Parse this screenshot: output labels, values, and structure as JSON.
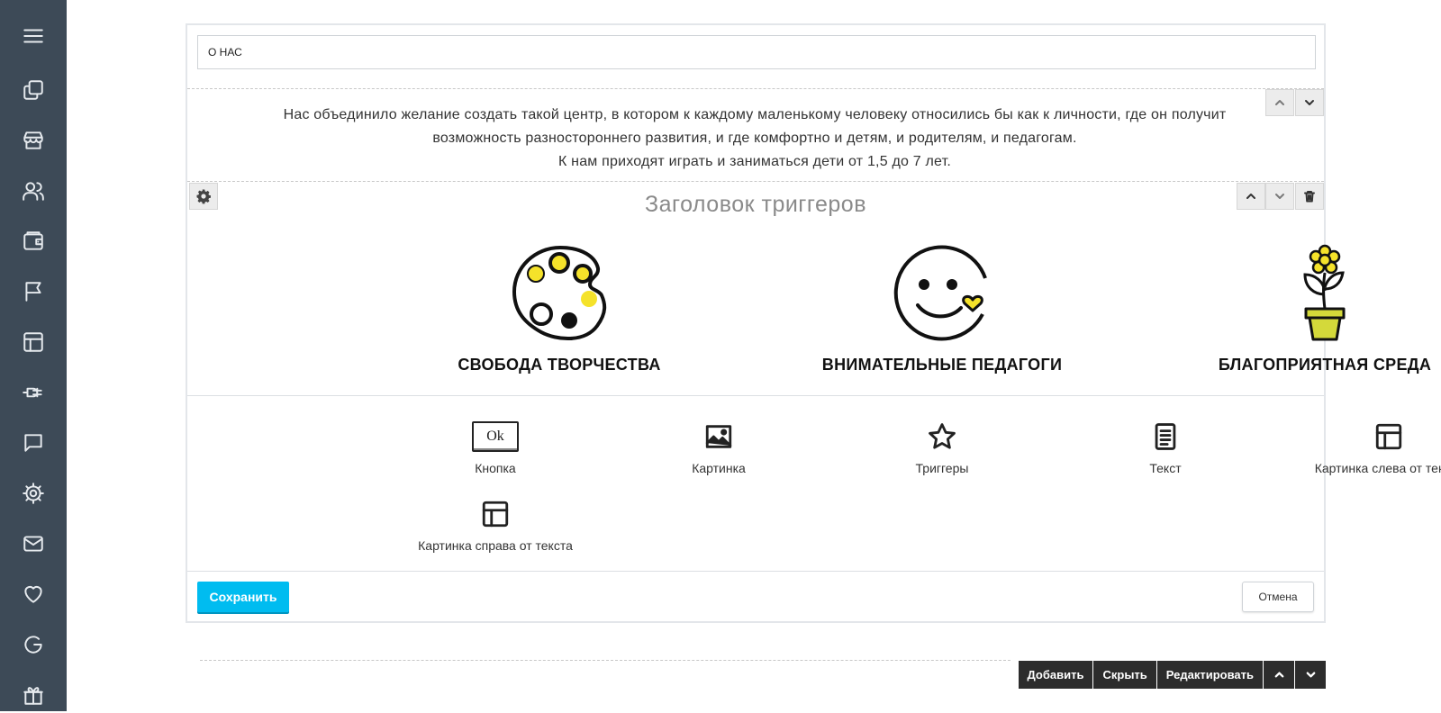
{
  "sidebar": {
    "icons": [
      "menu-icon",
      "copy-icon",
      "store-icon",
      "users-icon",
      "wallet-icon",
      "flag-icon",
      "layout-icon",
      "plug-icon",
      "chat-icon",
      "gear-icon",
      "mail-icon",
      "heart-icon",
      "google-icon",
      "gift-icon"
    ]
  },
  "editor": {
    "title_value": "О НАС",
    "paragraph_lines": [
      "Нас объединило желание создать такой центр, в котором к каждому маленькому человеку относились бы как к личности, где он получит",
      "возможность разностороннего развития, и где комфортно и детям, и родителям, и педагогам.",
      "К нам приходят играть и заниматься дети от 1,5 до 7 лет."
    ],
    "triggers_title": "Заголовок триггеров",
    "triggers": [
      {
        "label": "СВОБОДА ТВОРЧЕСТВА",
        "icon": "palette-icon"
      },
      {
        "label": "ВНИМАТЕЛЬНЫЕ ПЕДАГОГИ",
        "icon": "smiley-icon"
      },
      {
        "label": "БЛАГОПРИЯТНАЯ СРЕДА",
        "icon": "flower-pot-icon"
      }
    ],
    "blocks": [
      {
        "label": "Кнопка",
        "icon": "button-ok-icon",
        "icon_text": "Ok"
      },
      {
        "label": "Картинка",
        "icon": "image-icon"
      },
      {
        "label": "Триггеры",
        "icon": "star-icon"
      },
      {
        "label": "Текст",
        "icon": "document-icon"
      },
      {
        "label": "Картинка слева от текста",
        "icon": "layout-left-icon"
      },
      {
        "label": "Картинка справа от текста",
        "icon": "layout-right-icon"
      }
    ],
    "save_label": "Сохранить",
    "cancel_label": "Отмена"
  },
  "toolbar": {
    "add_label": "Добавить",
    "hide_label": "Скрыть",
    "edit_label": "Редактировать"
  },
  "colors": {
    "sidebar_bg": "#3d4a57",
    "accent": "#00bcf0",
    "icon_yellow": "#f5e22a",
    "toolbar_bg": "#2c2c2c"
  }
}
